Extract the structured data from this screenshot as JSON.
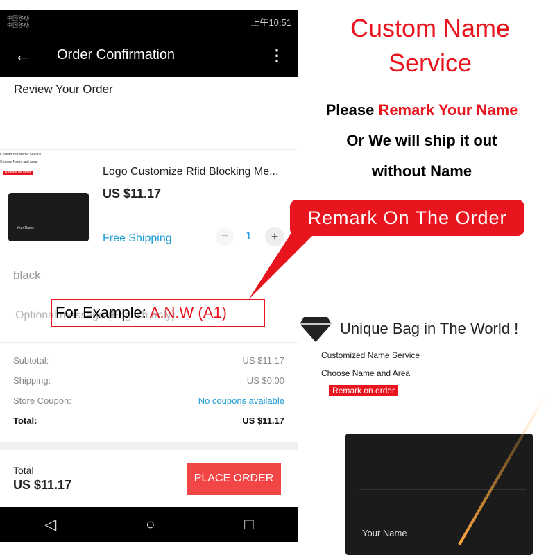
{
  "phone": {
    "status": {
      "carrier1": "中国移动",
      "carrier2": "中国移动",
      "icons": "vibrate alarm eye wifi signal signal battery",
      "time": "上午10:51"
    },
    "appbar": {
      "back_icon": "←",
      "title": "Order Confirmation",
      "more_icon": "⋮"
    },
    "review_title": "Review Your Order",
    "product": {
      "thumb_line1": "Customized Name Service",
      "thumb_line2": "Choose Name and Area",
      "thumb_badge": "Remark on order",
      "thumb_name": "Your Name",
      "name": "Logo Customize Rfid Blocking Me...",
      "price": "US $11.17",
      "shipping": "Free Shipping",
      "qty": "1",
      "minus": "−",
      "plus": "+",
      "color": "black"
    },
    "message_placeholder": "Optional message (English only)",
    "summary": [
      {
        "label": "Subtotal:",
        "value": "US $11.17"
      },
      {
        "label": "Shipping:",
        "value": "US $0.00"
      },
      {
        "label": "Store Coupon:",
        "value": "No coupons available"
      },
      {
        "label": "Total:",
        "value": "US $11.17"
      }
    ],
    "footer": {
      "total_label": "Total",
      "total_value": "US $11.17",
      "place_order": "PLACE ORDER"
    },
    "nav": {
      "back": "◁",
      "home": "○",
      "recent": "□"
    }
  },
  "promo": {
    "title1": "Custom Name",
    "title2": "Service",
    "line1a": "Please ",
    "line1b": "Remark Your Name",
    "line2": "Or We will ship it out",
    "line3": "without Name",
    "callout": "Remark On The Order",
    "example_label": "For Example: ",
    "example_value": "A.N.W (A1)"
  },
  "banner": {
    "headline": "Unique Bag in The World !",
    "line1": "Customized Name Service",
    "line2": "Choose Name and Area",
    "badge": "Remark on order",
    "wallet_name": "Your Name"
  },
  "colors": {
    "accent_red": "#e8141e",
    "link_blue": "#1a9bd1",
    "place_order": "#f24646"
  }
}
